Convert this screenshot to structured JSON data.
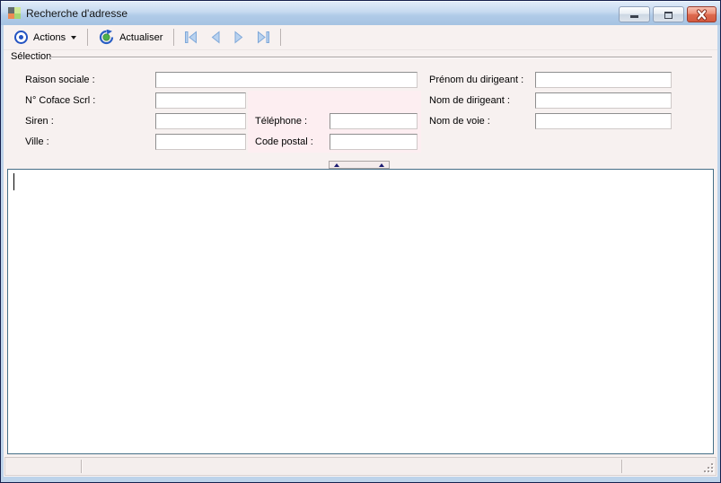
{
  "window": {
    "title": "Recherche d'adresse"
  },
  "toolbar": {
    "actions": {
      "label": "Actions",
      "icon": "bullseye-icon"
    },
    "refresh": {
      "label": "Actualiser",
      "icon": "refresh-icon"
    },
    "nav": {
      "first": "first-record-icon",
      "previous": "previous-record-icon",
      "next": "next-record-icon",
      "last": "last-record-icon"
    }
  },
  "selection": {
    "title": "Sélection",
    "fields": [
      {
        "id": "raison_sociale",
        "label": "Raison sociale :",
        "value": ""
      },
      {
        "id": "coface_scrl",
        "label": "N° Coface Scrl :",
        "value": ""
      },
      {
        "id": "siren",
        "label": "Siren :",
        "value": ""
      },
      {
        "id": "ville",
        "label": "Ville :",
        "value": ""
      },
      {
        "id": "telephone",
        "label": "Téléphone :",
        "value": ""
      },
      {
        "id": "code_postal",
        "label": "Code postal :",
        "value": ""
      },
      {
        "id": "prenom_dirigeant",
        "label": "Prénom du dirigeant :",
        "value": ""
      },
      {
        "id": "nom_dirigeant",
        "label": "Nom de dirigeant :",
        "value": ""
      },
      {
        "id": "nom_voie",
        "label": "Nom de voie :",
        "value": ""
      }
    ]
  },
  "results": {
    "rows": []
  },
  "statusbar": {
    "panels": [
      "",
      "",
      ""
    ]
  },
  "colors": {
    "titlebar_blue": "#b7cfe9",
    "frame_blue": "#bdd3ea",
    "client_background": "#f7f1f0",
    "highlight_panel_pink": "#fdeef1",
    "close_button_red": "#d4593e",
    "toolbar_icon_blue": "#2353c2",
    "refresh_center_green": "#4db04a",
    "nav_arrow_fill_blue": "#b9d2ef",
    "content_border_steel": "#466f87"
  }
}
